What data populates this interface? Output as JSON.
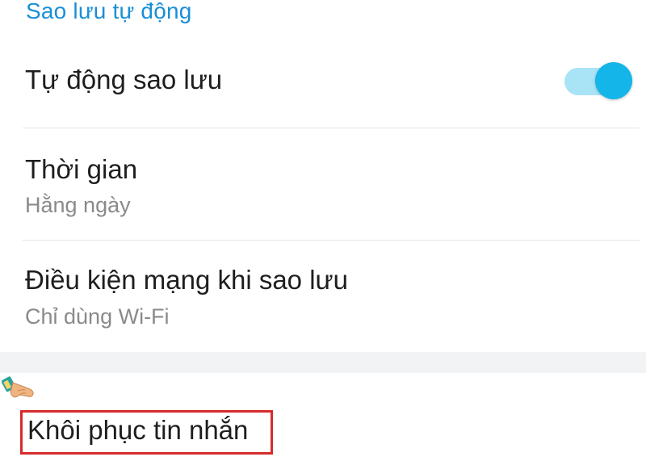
{
  "section": {
    "header": "Sao lưu tự động"
  },
  "settings": [
    {
      "title": "Tự động sao lưu",
      "toggle_on": true
    },
    {
      "title": "Thời gian",
      "subtitle": "Hằng ngày"
    },
    {
      "title": "Điều kiện mạng khi sao lưu",
      "subtitle": "Chỉ dùng Wi-Fi"
    }
  ],
  "restore": {
    "label": "Khôi phục tin nhắn"
  },
  "colors": {
    "accent": "#1a8fd6",
    "toggle_thumb": "#14b5e8",
    "toggle_track": "#a9e3f6",
    "highlight_border": "#d62b2b"
  },
  "icons": {
    "pointer": "pointing-hand-icon"
  }
}
